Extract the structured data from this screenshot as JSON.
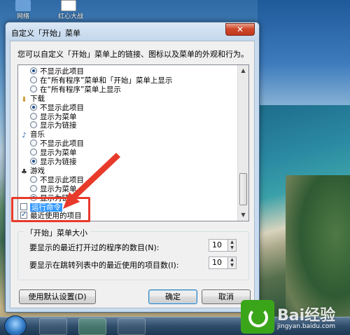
{
  "desktop": {
    "icons": [
      {
        "label": "网络",
        "icon": "network-icon"
      },
      {
        "label": "红心大战",
        "icon": "hearts-game-icon"
      }
    ]
  },
  "dialog": {
    "title": "自定义「开始」菜单",
    "close_symbol": "✕",
    "intro": "您可以自定义「开始」菜单上的链接、图标以及菜单的外观和行为。",
    "list": {
      "rows": [
        {
          "kind": "radio",
          "checked": true,
          "label": "不显示此项目"
        },
        {
          "kind": "radio",
          "checked": false,
          "label": "在“所有程序”菜单和「开始」菜单上显示"
        },
        {
          "kind": "radio",
          "checked": false,
          "label": "在“所有程序”菜单上显示"
        },
        {
          "kind": "category",
          "label": "下载",
          "icon": "downloads-icon"
        },
        {
          "kind": "radio",
          "checked": true,
          "label": "不显示此项目"
        },
        {
          "kind": "radio",
          "checked": false,
          "label": "显示为菜单"
        },
        {
          "kind": "radio",
          "checked": false,
          "label": "显示为链接"
        },
        {
          "kind": "category",
          "label": "音乐",
          "icon": "music-icon"
        },
        {
          "kind": "radio",
          "checked": false,
          "label": "不显示此项目"
        },
        {
          "kind": "radio",
          "checked": false,
          "label": "显示为菜单"
        },
        {
          "kind": "radio",
          "checked": true,
          "label": "显示为链接"
        },
        {
          "kind": "category",
          "label": "游戏",
          "icon": "games-icon"
        },
        {
          "kind": "radio",
          "checked": false,
          "label": "不显示此项目"
        },
        {
          "kind": "radio",
          "checked": false,
          "label": "显示为菜单"
        },
        {
          "kind": "radio",
          "checked": true,
          "label": "显示为链接"
        },
        {
          "kind": "check",
          "checked": false,
          "label": "运行命令",
          "selected": true
        },
        {
          "kind": "check",
          "checked": true,
          "label": "最近使用的项目"
        }
      ]
    },
    "size_group": {
      "legend": "「开始」菜单大小",
      "recent_programs_label": "要显示的最近打开过的程序的数目(N):",
      "recent_programs_value": "10",
      "jump_list_label": "要显示在跳转列表中的最近使用的项目数(I):",
      "jump_list_value": "10"
    },
    "buttons": {
      "defaults": "使用默认设置(D)",
      "ok": "确定",
      "cancel": "取消"
    }
  },
  "watermark": {
    "brand": "Bai经验",
    "url": "jingyan.baidu.com"
  },
  "colors": {
    "highlight_red": "#e83a2b",
    "selection_blue": "#3399ff"
  }
}
